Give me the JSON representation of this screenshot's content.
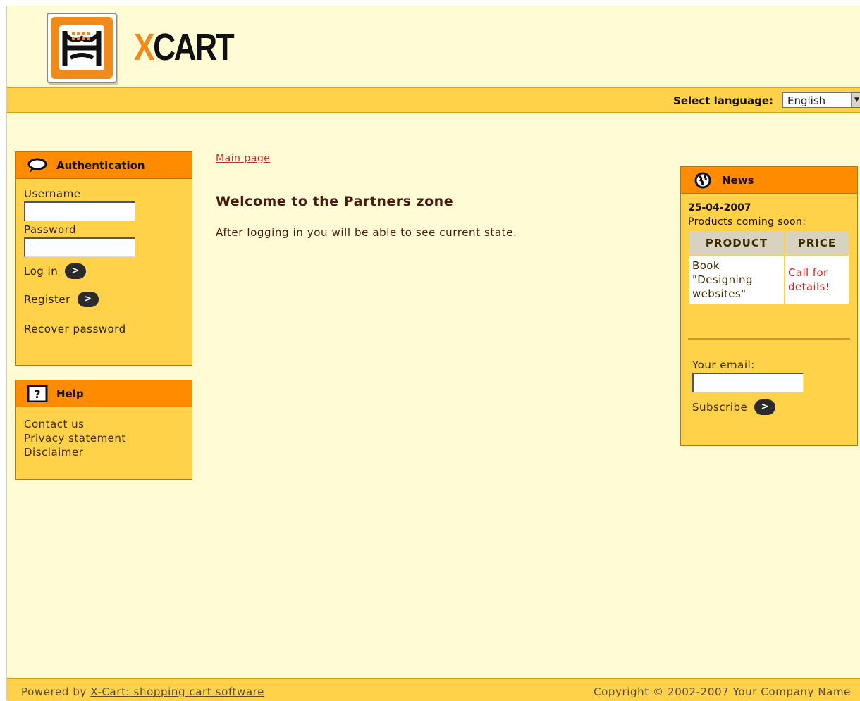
{
  "header": {
    "logo_x": "X",
    "logo_rest": "CART",
    "language_label": "Select language:",
    "language_value": "English"
  },
  "auth": {
    "title": "Authentication",
    "username_label": "Username",
    "password_label": "Password",
    "login_label": "Log in",
    "register_label": "Register",
    "recover_label": "Recover password"
  },
  "help": {
    "title": "Help",
    "items": [
      "Contact us",
      "Privacy statement",
      "Disclaimer"
    ]
  },
  "main": {
    "breadcrumb": "Main page",
    "title": "Welcome to the Partners zone",
    "text": "After logging in you will be able to see current state."
  },
  "news": {
    "title": "News",
    "date": "25-04-2007",
    "subtitle": "Products coming soon:",
    "table": {
      "headers": [
        "PRODUCT",
        "PRICE"
      ],
      "rows": [
        [
          "Book \"Designing websites\"",
          "Call for details!"
        ]
      ]
    },
    "email_label": "Your email:",
    "subscribe_label": "Subscribe"
  },
  "footer": {
    "powered_prefix": "Powered by ",
    "powered_link": "X-Cart: shopping cart software",
    "copyright": "Copyright © 2002-2007 Your Company Name"
  },
  "colors": {
    "page_bg": "#fffbd4",
    "bar": "#ffd24a",
    "box_head": "#ff8c00",
    "accent_red": "#e31b1b"
  }
}
